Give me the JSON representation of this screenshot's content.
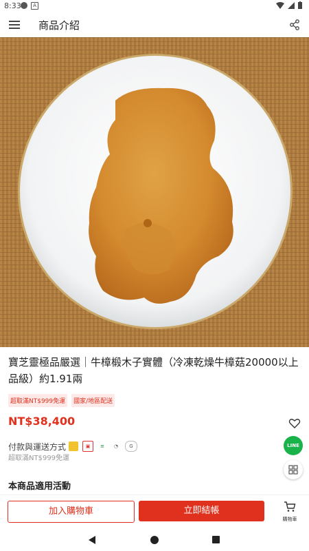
{
  "status_bar": {
    "time": "8:33"
  },
  "header": {
    "title": "商品介紹"
  },
  "product": {
    "title": "寶芝靈極品嚴選｜牛樟椴木子實體（冷凍乾燥牛樟菇20000以上品級）約1.91兩",
    "badges": [
      "超取滿NT$999免運",
      "國家/地區配送"
    ],
    "price": "NT$38,400",
    "payment_label": "付款與運送方式",
    "shipping_note": "超取滿NT$999免運",
    "promo_heading": "本商品適用活動"
  },
  "floating": {
    "line_label": "LINE"
  },
  "actions": {
    "add_to_cart": "加入購物車",
    "checkout": "立即結帳",
    "cart_label": "購物車"
  },
  "colors": {
    "accent": "#e0301e",
    "line_green": "#19b34a"
  },
  "icons": [
    "menu-icon",
    "share-icon",
    "heart-icon",
    "line-icon",
    "grid-icon",
    "cart-icon"
  ]
}
